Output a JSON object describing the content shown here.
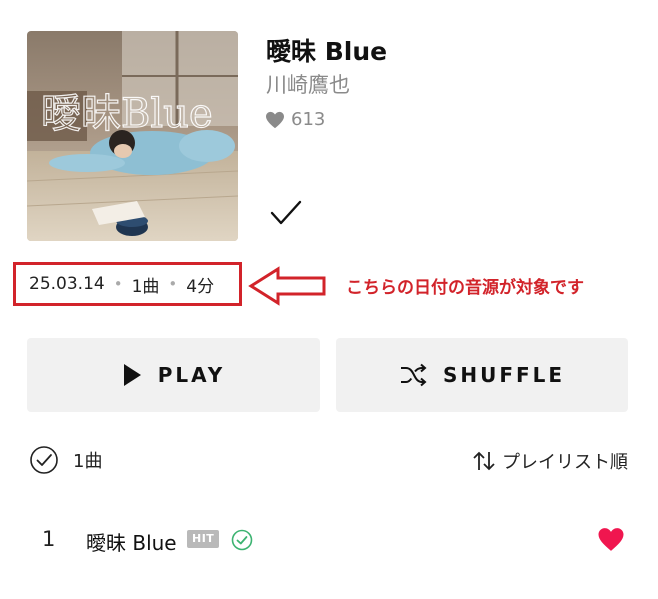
{
  "album": {
    "art_text": "曖昧Blue",
    "title": "曖昧 Blue",
    "artist": "川崎鷹也",
    "likes": "613",
    "added_icon": "checkmark-icon"
  },
  "meta": {
    "date": "25.03.14",
    "tracks": "1曲",
    "duration": "4分"
  },
  "annotation": {
    "note": "こちらの日付の音源が対象です",
    "accent_color": "#d2232a"
  },
  "actions": {
    "play_label": "PLAY",
    "shuffle_label": "SHUFFLE"
  },
  "list_header": {
    "count": "1曲",
    "sort_label": "プレイリスト順"
  },
  "tracks": [
    {
      "number": "1",
      "title": "曖昧 Blue",
      "badge": "HIT",
      "liked": true
    }
  ],
  "colors": {
    "heart": "#f0164f",
    "verified": "#3cb371",
    "button_bg": "#f1f1f1"
  }
}
